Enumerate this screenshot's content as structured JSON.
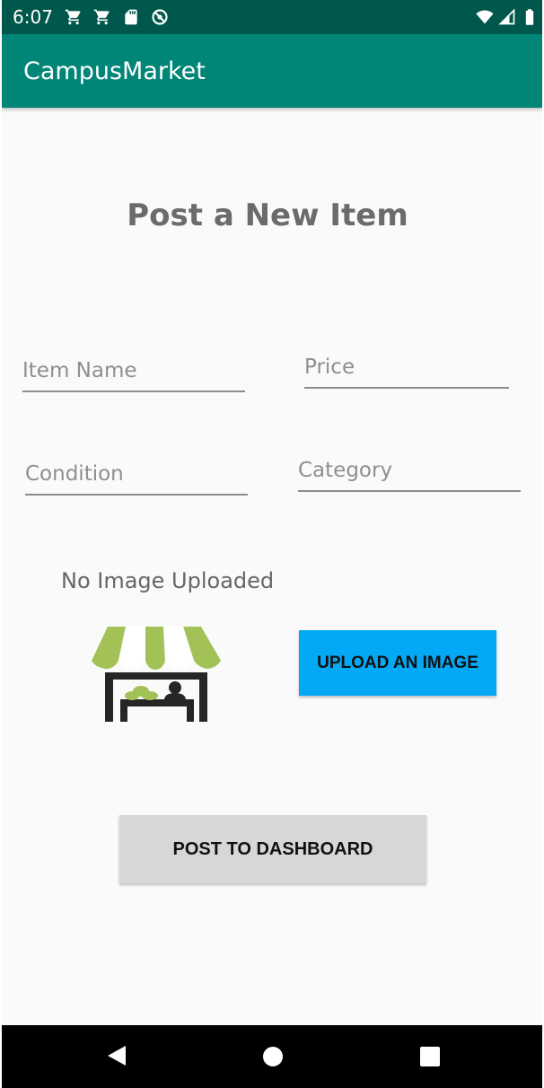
{
  "status_bar": {
    "time": "6:07",
    "left_icons": [
      "shopping-cart-icon",
      "shopping-cart-icon",
      "sd-card-icon",
      "no-entry-circle-icon"
    ],
    "right_icons": [
      "wifi-icon",
      "cell-signal-icon",
      "battery-icon"
    ]
  },
  "app_bar": {
    "title": "CampusMarket"
  },
  "form": {
    "title": "Post a New Item",
    "item_name": {
      "value": "",
      "placeholder": "Item Name"
    },
    "price": {
      "value": "",
      "placeholder": "Price"
    },
    "condition": {
      "value": "",
      "placeholder": "Condition"
    },
    "category": {
      "value": "",
      "placeholder": "Category"
    },
    "image_status": "No Image Uploaded",
    "image_placeholder_icon": "market-stall-icon",
    "upload_label": "UPLOAD AN IMAGE",
    "post_label": "POST TO DASHBOARD"
  },
  "nav_bar": {
    "icons": [
      "back-icon",
      "home-icon",
      "recents-icon"
    ]
  },
  "colors": {
    "status_bar": "#00574b",
    "app_bar": "#008577",
    "upload_button": "#03a9f4",
    "post_button": "#d6d7d7",
    "awning_green": "#a2c257",
    "background": "#fafafa"
  }
}
